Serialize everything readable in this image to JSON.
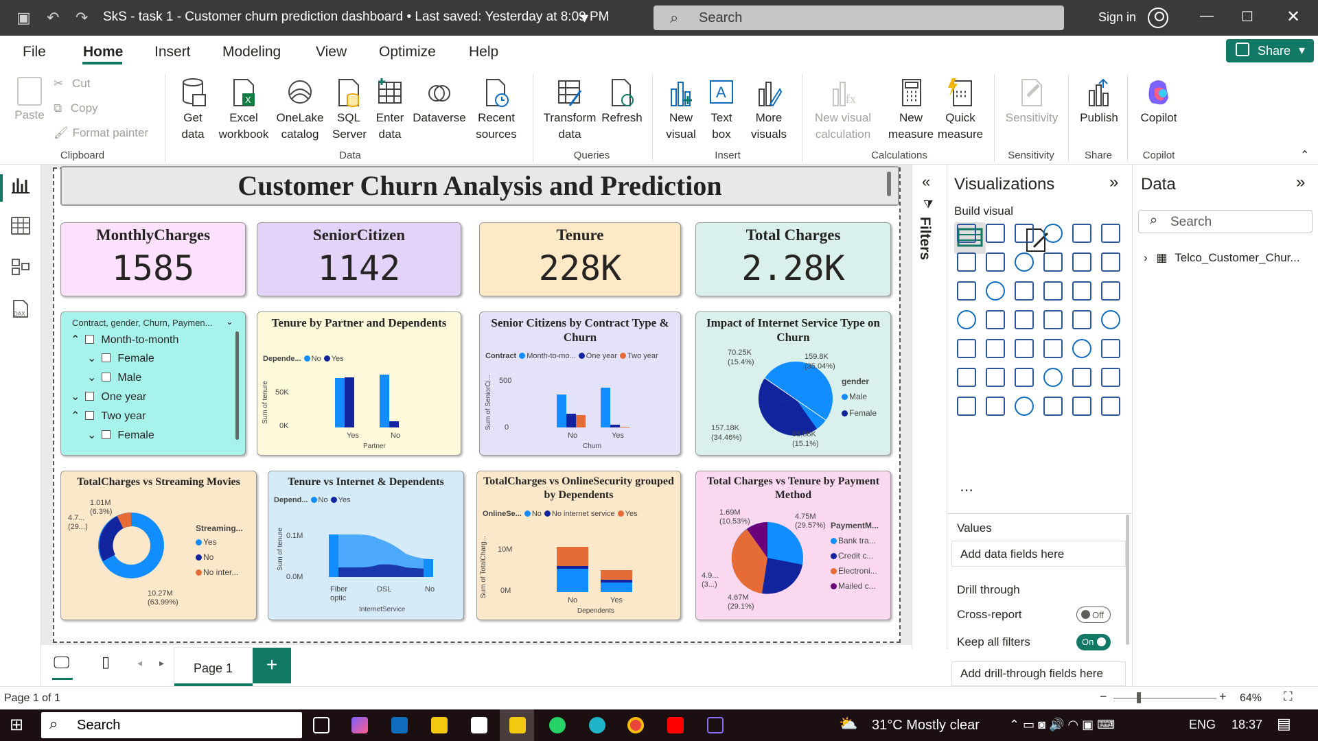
{
  "window": {
    "title": "SkS - task 1 - Customer churn prediction dashboard • Last saved: Yesterday at 8:09 PM",
    "search_placeholder": "Search",
    "sign_in": "Sign in"
  },
  "menu": {
    "items": [
      "File",
      "Home",
      "Insert",
      "Modeling",
      "View",
      "Optimize",
      "Help"
    ],
    "share_label": "Share"
  },
  "ribbon": {
    "clipboard": {
      "paste": "Paste",
      "cut": "Cut",
      "copy": "Copy",
      "format_painter": "Format painter",
      "group": "Clipboard"
    },
    "data": {
      "get_data": "Get data",
      "excel": "Excel workbook",
      "onelake": "OneLake catalog",
      "sql": "SQL Server",
      "enter": "Enter data",
      "dataverse": "Dataverse",
      "recent": "Recent sources",
      "group": "Data"
    },
    "queries": {
      "transform": "Transform data",
      "refresh": "Refresh",
      "group": "Queries"
    },
    "insert": {
      "new_visual": "New visual",
      "text_box": "Text box",
      "more_visuals": "More visuals",
      "group": "Insert"
    },
    "calculations": {
      "new_visual_calc": "New visual calculation",
      "new_measure": "New measure",
      "quick_measure": "Quick measure",
      "group": "Calculations"
    },
    "sensitivity": {
      "label": "Sensitivity",
      "group": "Sensitivity"
    },
    "share": {
      "publish": "Publish",
      "group": "Share"
    },
    "copilot": {
      "label": "Copilot",
      "group": "Copilot"
    }
  },
  "report": {
    "title": "Customer Churn Analysis and Prediction",
    "kpis": [
      {
        "label": "MonthlyCharges",
        "value": "1585",
        "color": "#fbe1fb"
      },
      {
        "label": "SeniorCitizen",
        "value": "1142",
        "color": "#e3d3f8"
      },
      {
        "label": "Tenure",
        "value": "228K",
        "color": "#fde9c5"
      },
      {
        "label": "Total Charges",
        "value": "2.28K",
        "color": "#d9f0ec"
      }
    ],
    "slicer": {
      "header": "Contract, gender, Churn, Paymen...",
      "rows": [
        "Month-to-month",
        "Female",
        "Male",
        "One year",
        "Two year",
        "Female"
      ]
    },
    "tenure_partner": {
      "title": "Tenure by Partner and Dependents",
      "legend_title": "Depende...",
      "legend": [
        "No",
        "Yes"
      ],
      "ylabel": "Sum of tenure",
      "xlabel": "Partner",
      "ticks": [
        "50K",
        "0K"
      ],
      "categories": [
        "Yes",
        "No"
      ]
    },
    "senior_contract": {
      "title": "Senior Citizens by Contract Type & Churn",
      "legend_title": "Contract",
      "legend": [
        "Month-to-mo...",
        "One year",
        "Two year"
      ],
      "ylabel": "Sum of SeniorCi...",
      "xlabel": "Churn",
      "ticks": [
        "500",
        "0"
      ],
      "categories": [
        "No",
        "Yes"
      ]
    },
    "internet_pie": {
      "title": "Impact of Internet Service Type on Churn",
      "legend_title": "gender",
      "legend": [
        "Male",
        "Female"
      ],
      "labels": [
        "70.25K (15.4%)",
        "159.8K (35.04%)",
        "157.18K (34.46%)",
        "68.88K (15.1%)"
      ]
    },
    "streaming": {
      "title": "TotalCharges vs Streaming Movies",
      "legend_title": "Streaming...",
      "legend": [
        "Yes",
        "No",
        "No inter..."
      ],
      "labels": [
        "1.01M (6.3%)",
        "4.7... (29...)",
        "10.27M (63.99%)"
      ]
    },
    "tenure_internet": {
      "title": "Tenure vs Internet & Dependents",
      "legend_title": "Depend...",
      "legend": [
        "No",
        "Yes"
      ],
      "ylabel": "Sum of tenure",
      "xlabel": "InternetService",
      "ticks": [
        "0.1M",
        "0.0M"
      ],
      "categories": [
        "Fiber optic",
        "DSL",
        "No"
      ]
    },
    "online_security": {
      "title": "TotalCharges vs OnlineSecurity grouped by Dependents",
      "legend_title": "OnlineSe...",
      "legend": [
        "No",
        "No internet service",
        "Yes"
      ],
      "ylabel": "Sum of TotalCharg...",
      "xlabel": "Dependents",
      "ticks": [
        "10M",
        "0M"
      ],
      "categories": [
        "No",
        "Yes"
      ]
    },
    "payment_pie": {
      "title": "Total Charges vs Tenure by Payment Method",
      "legend_title": "PaymentM...",
      "legend": [
        "Bank tra...",
        "Credit c...",
        "Electroni...",
        "Mailed c..."
      ],
      "labels": [
        "1.69M (10.53%)",
        "4.75M (29.57%)",
        "4.9... (3...)",
        "4.67M (29.1%)"
      ]
    }
  },
  "panes": {
    "filters": "Filters",
    "visualizations": "Visualizations",
    "build_visual": "Build visual",
    "values": "Values",
    "add_fields": "Add data fields here",
    "drill_through": "Drill through",
    "cross_report": "Cross-report",
    "cross_state": "Off",
    "keep_filters": "Keep all filters",
    "keep_state": "On",
    "add_drill": "Add drill-through fields here",
    "data": "Data",
    "data_search": "Search",
    "table": "Telco_Customer_Chur..."
  },
  "pages": {
    "tab": "Page 1",
    "status": "Page 1 of 1",
    "zoom": "64%"
  },
  "taskbar": {
    "search": "Search",
    "weather": "31°C  Mostly clear",
    "lang": "ENG",
    "time": "18:37"
  }
}
